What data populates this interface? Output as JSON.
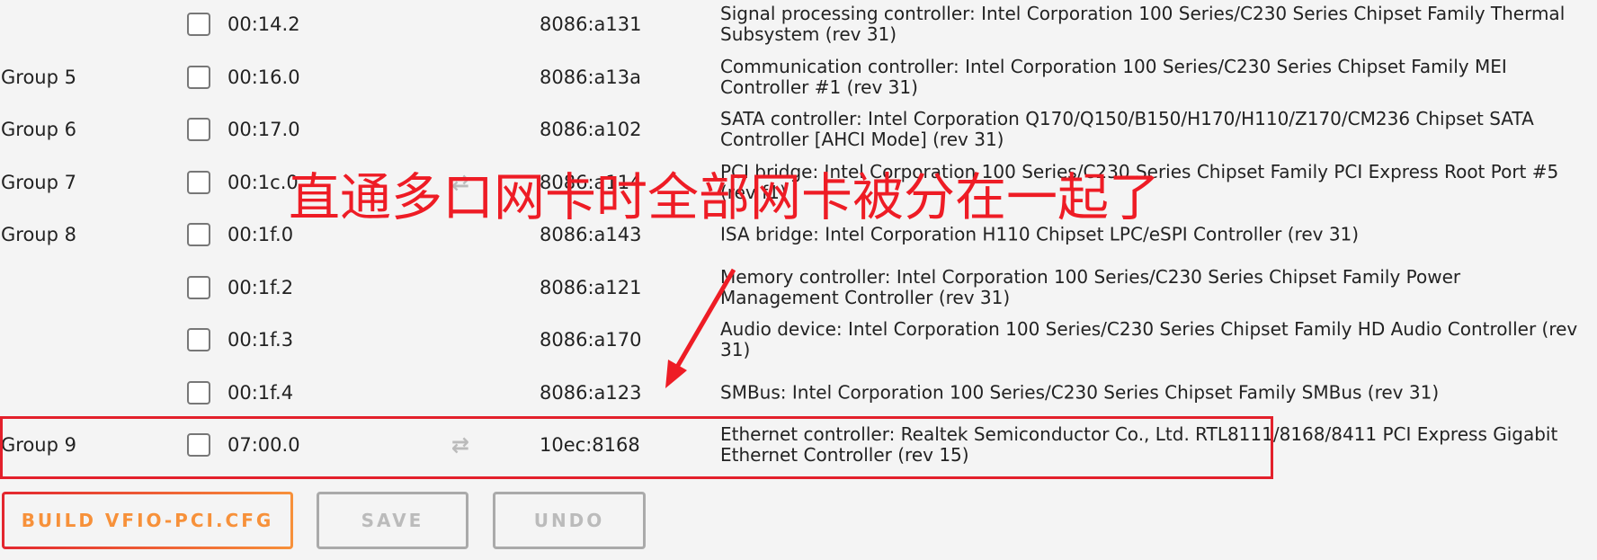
{
  "rows": [
    {
      "group": "",
      "bdf": "00:14.2",
      "reset": false,
      "id": "8086:a131",
      "desc": "Signal processing controller: Intel Corporation 100 Series/C230 Series Chipset Family Thermal Subsystem (rev 31)"
    },
    {
      "group": "Group 5",
      "bdf": "00:16.0",
      "reset": false,
      "id": "8086:a13a",
      "desc": "Communication controller: Intel Corporation 100 Series/C230 Series Chipset Family MEI Controller #1 (rev 31)"
    },
    {
      "group": "Group 6",
      "bdf": "00:17.0",
      "reset": false,
      "id": "8086:a102",
      "desc": "SATA controller: Intel Corporation Q170/Q150/B150/H170/H110/Z170/CM236 Chipset SATA Controller [AHCI Mode] (rev 31)"
    },
    {
      "group": "Group 7",
      "bdf": "00:1c.0",
      "reset": true,
      "id": "8086:a114",
      "desc": "PCI bridge: Intel Corporation 100 Series/C230 Series Chipset Family PCI Express Root Port #5 (rev f1)"
    },
    {
      "group": "Group 8",
      "bdf": "00:1f.0",
      "reset": false,
      "id": "8086:a143",
      "desc": "ISA bridge: Intel Corporation H110 Chipset LPC/eSPI Controller (rev 31)"
    },
    {
      "group": "",
      "bdf": "00:1f.2",
      "reset": false,
      "id": "8086:a121",
      "desc": "Memory controller: Intel Corporation 100 Series/C230 Series Chipset Family Power Management Controller (rev 31)"
    },
    {
      "group": "",
      "bdf": "00:1f.3",
      "reset": false,
      "id": "8086:a170",
      "desc": "Audio device: Intel Corporation 100 Series/C230 Series Chipset Family HD Audio Controller (rev 31)"
    },
    {
      "group": "",
      "bdf": "00:1f.4",
      "reset": false,
      "id": "8086:a123",
      "desc": "SMBus: Intel Corporation 100 Series/C230 Series Chipset Family SMBus (rev 31)"
    },
    {
      "group": "Group 9",
      "bdf": "07:00.0",
      "reset": true,
      "id": "10ec:8168",
      "desc": "Ethernet controller: Realtek Semiconductor Co., Ltd. RTL8111/8168/8411 PCI Express Gigabit Ethernet Controller (rev 15)"
    }
  ],
  "reset_icon": "repeat-icon",
  "buttons": {
    "build": "BUILD VFIO-PCI.CFG",
    "save": "SAVE",
    "undo": "UNDO"
  },
  "annotation": {
    "text": "直通多口网卡时全部网卡被分在一起了",
    "color": "#ee1c25"
  },
  "colors": {
    "accent": "#f7913a",
    "highlight": "#e3202b",
    "background": "#f4f4f4"
  }
}
